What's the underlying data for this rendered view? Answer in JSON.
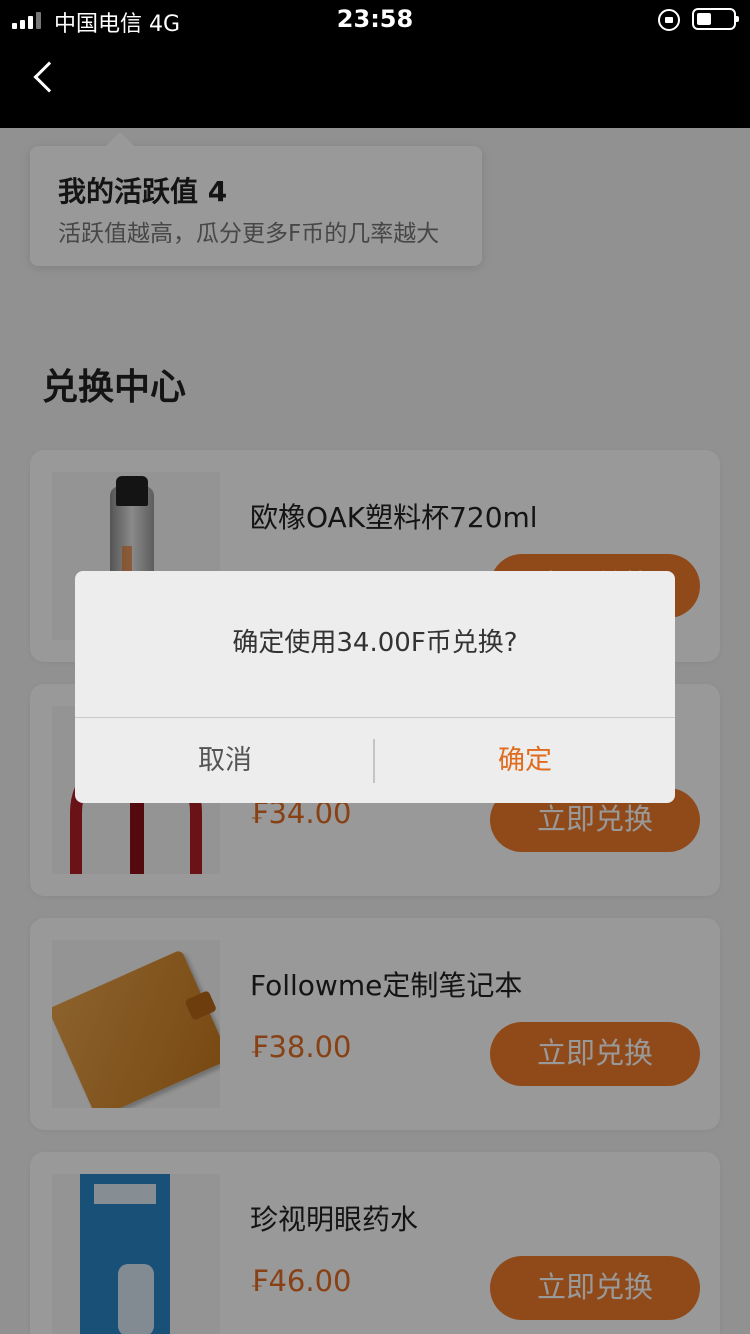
{
  "status_bar": {
    "carrier": "中国电信 4G",
    "time": "23:58"
  },
  "activity": {
    "title": "我的活跃值 4",
    "subtitle": "活跃值越高，瓜分更多F币的几率越大"
  },
  "section_title": "兑换中心",
  "products": [
    {
      "name": "欧橡OAK塑料杯720ml",
      "price": "",
      "button": "立即兑换"
    },
    {
      "name": "",
      "price": "₣34.00",
      "button": "立即兑换"
    },
    {
      "name": "Followme定制笔记本",
      "price": "₣38.00",
      "button": "立即兑换"
    },
    {
      "name": "珍视明眼药水",
      "price": "₣46.00",
      "button": "立即兑换"
    }
  ],
  "dialog": {
    "message": "确定使用34.00F币兑换?",
    "cancel_label": "取消",
    "confirm_label": "确定"
  },
  "colors": {
    "accent": "#f07c2c",
    "price": "#e36d22",
    "topbar": "#000000"
  },
  "icons": [
    "signal-icon",
    "lock-rotation-icon",
    "battery-icon",
    "back-arrow-icon"
  ]
}
